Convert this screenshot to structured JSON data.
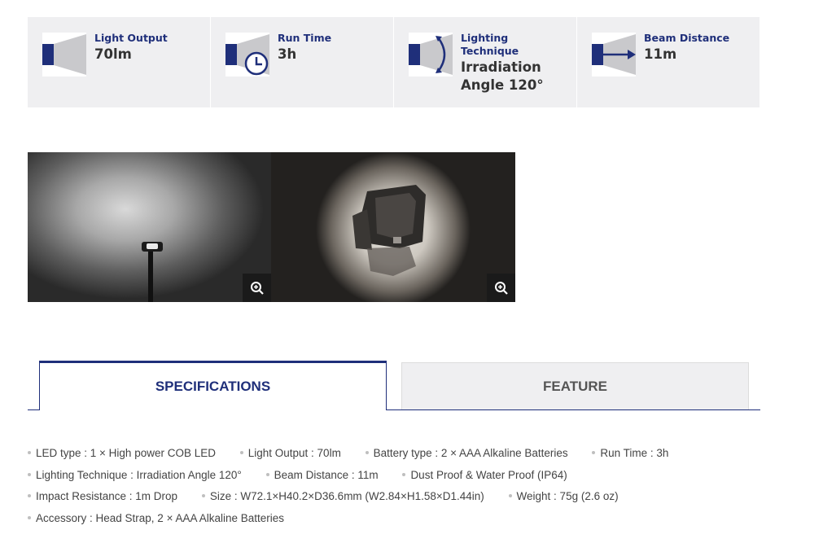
{
  "tiles": [
    {
      "label": "Light Output",
      "value": "70lm",
      "icon": "light-output-icon"
    },
    {
      "label": "Run Time",
      "value": "3h",
      "icon": "run-time-icon"
    },
    {
      "label": "Lighting Technique",
      "value": "Irradiation Angle 120°",
      "icon": "lighting-technique-icon"
    },
    {
      "label": "Beam Distance",
      "value": "11m",
      "icon": "beam-distance-icon"
    }
  ],
  "tabs": {
    "specifications": "SPECIFICATIONS",
    "feature": "FEATURE"
  },
  "specs": [
    [
      "LED type : 1 × High power COB LED",
      "Light Output : 70lm",
      "Battery type : 2 × AAA Alkaline Batteries",
      "Run Time : 3h"
    ],
    [
      "Lighting Technique : Irradiation Angle 120°",
      "Beam Distance : 11m",
      "Dust Proof & Water Proof (IP64)"
    ],
    [
      "Impact Resistance : 1m Drop",
      "Size : W72.1×H40.2×D36.6mm (W2.84×H1.58×D1.44in)",
      "Weight : 75g (2.6 oz)"
    ],
    [
      "Accessory : Head Strap, 2 × AAA Alkaline Batteries"
    ]
  ],
  "colors": {
    "accent": "#1f2f7a",
    "tile_bg": "#efeff1",
    "inactive_tab_bg": "#efeff1"
  }
}
